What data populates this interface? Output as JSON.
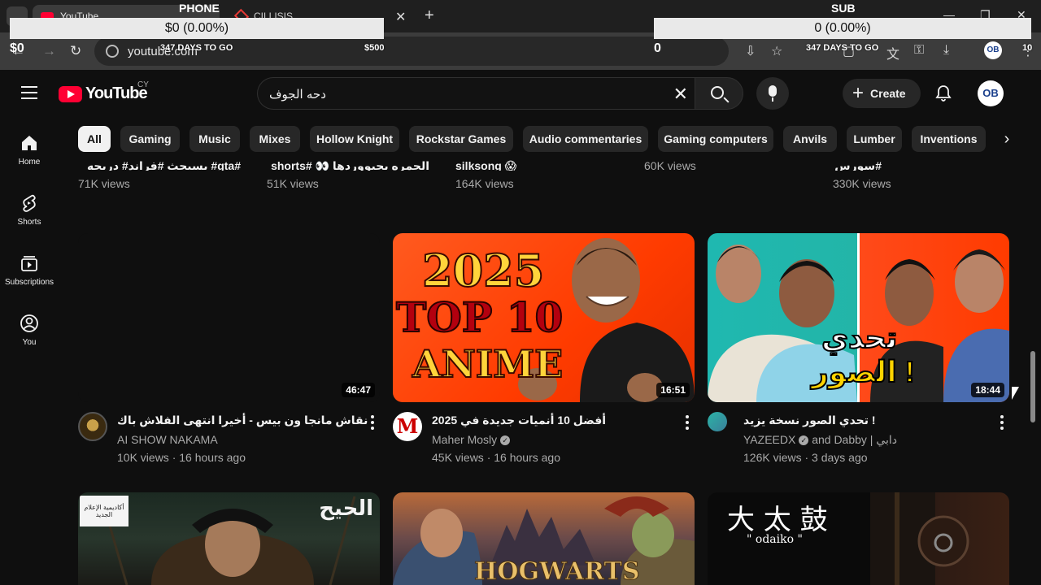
{
  "browser": {
    "active_tab_title": "YouTube",
    "other_tab_title": "CILLISIS",
    "url": "youtube.com"
  },
  "overlay": {
    "left_title": "PHONE",
    "left_bar": "$0 (0.00%)",
    "left_amount": "$0",
    "left_days": "347 DAYS TO GO",
    "left_goal": "$500",
    "right_title": "SUB",
    "right_bar": "0 (0.00%)",
    "right_amount": "0",
    "right_days": "347 DAYS TO GO",
    "right_goal": "10"
  },
  "youtube": {
    "logo_text": "YouTube",
    "country_code": "CY",
    "search_query": "دحه الجوف",
    "create_label": "Create",
    "avatar_initials": "OB"
  },
  "guide": [
    {
      "label": "Home",
      "icon": "home-icon"
    },
    {
      "label": "Shorts",
      "icon": "shorts-icon"
    },
    {
      "label": "Subscriptions",
      "icon": "subscriptions-icon"
    },
    {
      "label": "You",
      "icon": "you-icon"
    }
  ],
  "chips": [
    "All",
    "Gaming",
    "Music",
    "Mixes",
    "Hollow Knight",
    "Rockstar Games",
    "Audio commentaries",
    "Gaming computers",
    "Anvils",
    "Lumber",
    "Inventions"
  ],
  "cut_row": [
    {
      "title": "#gta# يسبحث #فراند# دريحه",
      "views": "71K views"
    },
    {
      "title": "الحمره بحيووردها 👀 #shorts",
      "views": "51K views"
    },
    {
      "title": "silksong 😱",
      "views": "164K views"
    },
    {
      "title": "",
      "views": "60K views"
    },
    {
      "title": "#سورس",
      "views": "330K views"
    }
  ],
  "videos": [
    {
      "title": "نقاش مانجا ون بيس - أخيرا انتهى الفلاش باك",
      "channel": "AI SHOW NAKAMA",
      "meta": "10K views · 16 hours ago",
      "duration": "46:47",
      "verified": false
    },
    {
      "title": "أفضل 10 أنميات جديدة في 2025",
      "channel": "Maher Mosly",
      "meta": "45K views · 16 hours ago",
      "duration": "16:51",
      "verified": true,
      "thumb_text_1": "2025",
      "thumb_text_2": "TOP 10",
      "thumb_text_3": "ANIME"
    },
    {
      "title": "تحدي الصور نسخة يزيد !",
      "channel": "YAZEEDX",
      "channel_suffix": "and Dabby | دابي",
      "meta": "126K views · 3 days ago",
      "duration": "18:44",
      "verified": true,
      "thumb_text_1": "تحدي",
      "thumb_text_2": "الصور !"
    }
  ],
  "bottom_row": [
    {
      "thumb_text": "الحيح",
      "badge": "أكاديمية الإعلام الجديد"
    },
    {
      "thumb_text": "HOGWARTS"
    },
    {
      "thumb_text": "大 太 鼓",
      "thumb_sub": "\" odaiko \""
    }
  ]
}
